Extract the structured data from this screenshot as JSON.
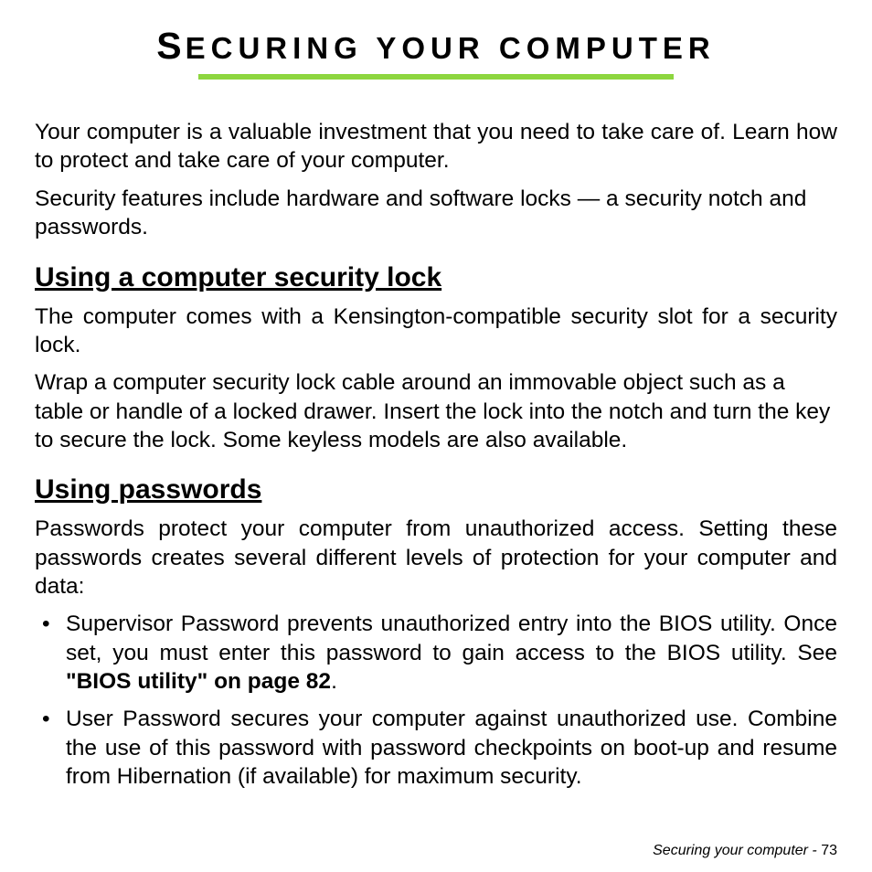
{
  "title": {
    "bigS": "S",
    "rest": "ECURING YOUR COMPUTER"
  },
  "intro": {
    "p1": "Your computer is a valuable investment that you need to take care of. Learn how to protect and take care of your computer.",
    "p2": "Security features include hardware and software locks — a security notch and passwords."
  },
  "section1": {
    "heading": "Using a computer security lock",
    "p1": "The computer comes with a Kensington-compatible security slot for a security lock.",
    "p2": "Wrap a computer security lock cable around an immovable object such as a table or handle of a locked drawer. Insert the lock into the notch and turn the key to secure the lock. Some keyless models are also available."
  },
  "section2": {
    "heading": "Using passwords",
    "p1": "Passwords protect your computer from unauthorized access. Setting these passwords creates several different levels of protection for your computer and data:",
    "bullets": [
      {
        "pre": "Supervisor Password prevents unauthorized entry into the BIOS utility. Once set, you must enter this password to gain access to the BIOS utility. See ",
        "bold": "\"BIOS utility\" on page 82",
        "post": "."
      },
      {
        "pre": "User Password secures your computer against unauthorized use. Combine the use of this password with password checkpoints on boot-up and resume from Hibernation (if available) for maximum security.",
        "bold": "",
        "post": ""
      }
    ]
  },
  "footer": {
    "label": "Securing your computer -  ",
    "page": "73"
  }
}
